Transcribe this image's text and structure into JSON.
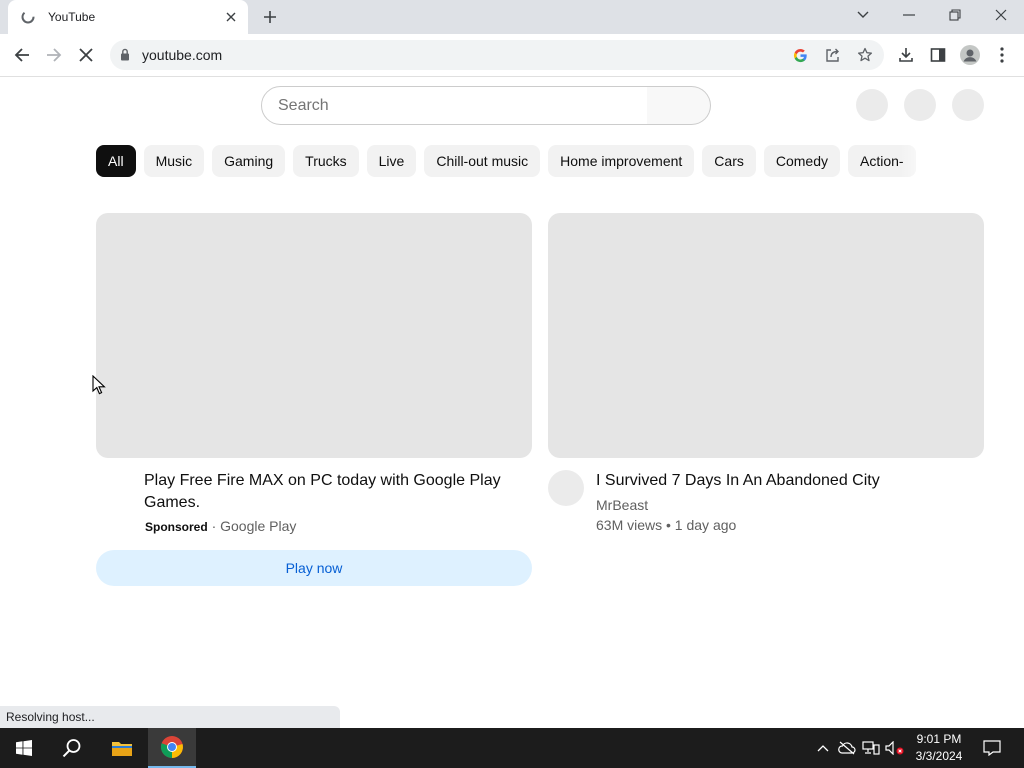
{
  "browser": {
    "tab_title": "YouTube",
    "url": "youtube.com",
    "status_text": "Resolving host..."
  },
  "page": {
    "search_placeholder": "Search",
    "chips": [
      "All",
      "Music",
      "Gaming",
      "Trucks",
      "Live",
      "Chill-out music",
      "Home improvement",
      "Cars",
      "Comedy",
      "Action-"
    ],
    "active_chip": "All",
    "ad": {
      "title": "Play Free Fire MAX on PC today with Google Play Games.",
      "sponsored_label": "Sponsored",
      "separator": "·",
      "advertiser": "Google Play",
      "cta": "Play now"
    },
    "video": {
      "title": "I Survived 7 Days In An Abandoned City",
      "channel": "MrBeast",
      "stats": "63M views • 1 day ago"
    }
  },
  "taskbar": {
    "time": "9:01 PM",
    "date": "3/3/2024"
  },
  "colors": {
    "tab_strip": "#dee1e6",
    "chip_active": "#0f0f0f",
    "cta_bg": "#def1ff",
    "cta_text": "#065fd4",
    "taskbar": "#1c1c1c"
  }
}
